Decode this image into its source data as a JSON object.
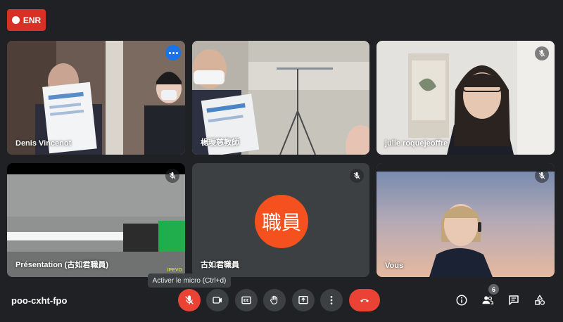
{
  "recording": {
    "label": "ENR"
  },
  "tiles": [
    {
      "name": "Denis Vincenot"
    },
    {
      "name": "楊璦慈教師"
    },
    {
      "name": "julie roquejeoffre"
    },
    {
      "name": "Présentation (古如君職員)",
      "brand_text": "IPEVO"
    },
    {
      "name": "古如君職員",
      "avatar_text": "職員"
    },
    {
      "name": "Vous"
    }
  ],
  "tooltip": {
    "text": "Activer le micro (Ctrl+d)"
  },
  "meeting": {
    "code": "poo-cxht-fpo"
  },
  "participants": {
    "count": "6"
  },
  "colors": {
    "background": "#202124",
    "tile": "#3c4043",
    "danger": "#ea4335",
    "accent": "#1a73e8",
    "avatar": "#f4511e"
  },
  "icons": [
    "mic-off-icon",
    "camera-icon",
    "captions-icon",
    "hand-icon",
    "present-icon",
    "more-vert-icon",
    "hang-up-icon",
    "info-icon",
    "people-icon",
    "chat-icon",
    "activities-icon"
  ]
}
